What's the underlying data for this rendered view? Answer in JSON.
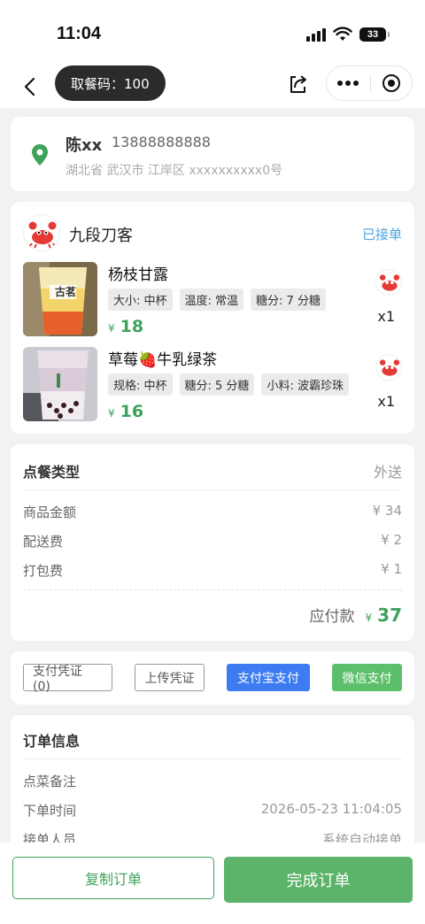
{
  "status_bar": {
    "time": "11:04",
    "battery": "33"
  },
  "nav": {
    "pickup_code": "取餐码：100"
  },
  "address": {
    "name": "陈xx",
    "phone": "13888888888",
    "line": "湖北省 武汉市 江岸区 xxxxxxxxxx0号"
  },
  "shop": {
    "name": "九段刀客",
    "status": "已接单"
  },
  "items": [
    {
      "name": "杨枝甘露",
      "tags": [
        "大小: 中杯",
        "温度: 常温",
        "糖分: 7 分糖"
      ],
      "currency": "¥",
      "price": "18",
      "qty": "x1",
      "thumb_label": "古茗"
    },
    {
      "name": "草莓🍓牛乳绿茶",
      "tags": [
        "规格: 中杯",
        "糖分: 5 分糖",
        "小料: 波霸珍珠"
      ],
      "currency": "¥",
      "price": "16",
      "qty": "x1"
    }
  ],
  "summary": {
    "type_label": "点餐类型",
    "type_value": "外送",
    "goods_label": "商品金额",
    "goods_value": "¥ 34",
    "delivery_label": "配送费",
    "delivery_value": "¥ 2",
    "packing_label": "打包费",
    "packing_value": "¥ 1",
    "total_label": "应付款",
    "total_currency": "¥",
    "total_value": "37"
  },
  "payment": {
    "voucher": "支付凭证 (0)",
    "upload": "上传凭证",
    "alipay": "支付宝支付",
    "wechat": "微信支付"
  },
  "info": {
    "title": "订单信息",
    "remark_label": "点菜备注",
    "time_label": "下单时间",
    "time_value": "2026-05-23 11:04:05",
    "receiver_label": "接单人员",
    "receiver_value": "系统自动接单"
  },
  "actions": {
    "copy": "复制订单",
    "complete": "完成订单"
  },
  "colors": {
    "green": "#3da35b",
    "blue": "#4aa5e6",
    "alipay": "#3d7cf0",
    "wechat": "#5cbf6c"
  }
}
